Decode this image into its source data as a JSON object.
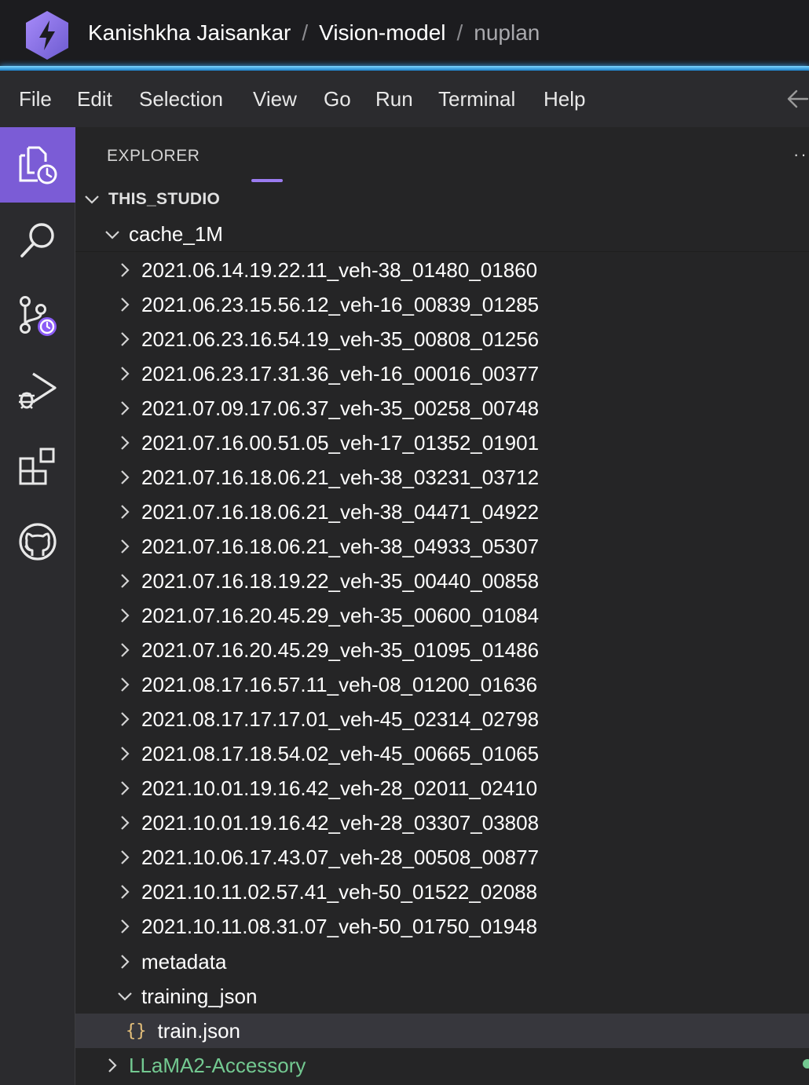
{
  "header": {
    "breadcrumbs": [
      "Kanishkha Jaisankar",
      "Vision-model",
      "nuplan"
    ],
    "separator": "/",
    "logo_icon": "lightning-hexagon-icon",
    "accent": "#8b5cf6"
  },
  "menu": {
    "items": [
      "File",
      "Edit",
      "Selection",
      "View",
      "Go",
      "Run",
      "Terminal",
      "Help"
    ],
    "back_icon": "arrow-left-icon"
  },
  "activity_bar": {
    "items": [
      {
        "icon": "explorer-icon",
        "active": true
      },
      {
        "icon": "search-icon",
        "active": false
      },
      {
        "icon": "source-control-icon",
        "active": false
      },
      {
        "icon": "run-debug-icon",
        "active": false
      },
      {
        "icon": "extensions-icon",
        "active": false
      },
      {
        "icon": "github-icon",
        "active": false
      }
    ],
    "active_color": "#7b5cd6"
  },
  "explorer": {
    "title": "EXPLORER",
    "more": "··",
    "section": "THIS_STUDIO",
    "root_folder": "cache_1M",
    "folders": [
      "2021.06.14.19.22.11_veh-38_01480_01860",
      "2021.06.23.15.56.12_veh-16_00839_01285",
      "2021.06.23.16.54.19_veh-35_00808_01256",
      "2021.06.23.17.31.36_veh-16_00016_00377",
      "2021.07.09.17.06.37_veh-35_00258_00748",
      "2021.07.16.00.51.05_veh-17_01352_01901",
      "2021.07.16.18.06.21_veh-38_03231_03712",
      "2021.07.16.18.06.21_veh-38_04471_04922",
      "2021.07.16.18.06.21_veh-38_04933_05307",
      "2021.07.16.18.19.22_veh-35_00440_00858",
      "2021.07.16.20.45.29_veh-35_00600_01084",
      "2021.07.16.20.45.29_veh-35_01095_01486",
      "2021.08.17.16.57.11_veh-08_01200_01636",
      "2021.08.17.17.17.01_veh-45_02314_02798",
      "2021.08.17.18.54.02_veh-45_00665_01065",
      "2021.10.01.19.16.42_veh-28_02011_02410",
      "2021.10.01.19.16.42_veh-28_03307_03808",
      "2021.10.06.17.43.07_veh-28_00508_00877",
      "2021.10.11.02.57.41_veh-50_01522_02088",
      "2021.10.11.08.31.07_veh-50_01750_01948"
    ],
    "metadata_folder": "metadata",
    "training_folder": "training_json",
    "selected_file": "train.json",
    "json_icon_glyph": "{}",
    "next_root_folder": "LLaMA2-Accessory",
    "modified_color": "#73c991"
  }
}
